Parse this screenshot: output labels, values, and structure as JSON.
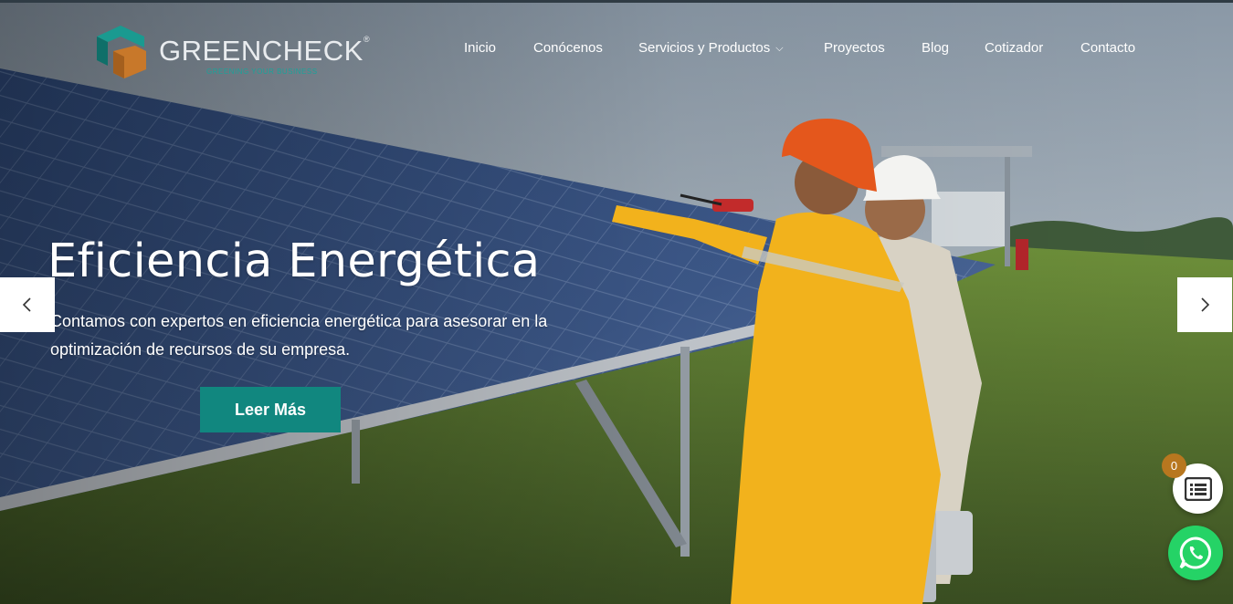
{
  "brand": {
    "name": "GREENCHECK",
    "registered_mark": "®",
    "tagline": "GREENING YOUR BUSINESS",
    "logo_colors": {
      "teal": "#1a9a90",
      "orange": "#c8782a",
      "dark_teal": "#0f6f69"
    }
  },
  "nav": {
    "items": [
      {
        "label": "Inicio",
        "has_dropdown": false
      },
      {
        "label": "Conócenos",
        "has_dropdown": false
      },
      {
        "label": "Servicios y Productos",
        "has_dropdown": true
      },
      {
        "label": "Proyectos",
        "has_dropdown": false
      },
      {
        "label": "Blog",
        "has_dropdown": false
      },
      {
        "label": "Cotizador",
        "has_dropdown": false
      },
      {
        "label": "Contacto",
        "has_dropdown": false
      }
    ]
  },
  "hero": {
    "title": "Eficiencia Energética",
    "subtitle": "Contamos con expertos en eficiencia energética para asesorar en la optimización de recursos de su empresa.",
    "cta_label": "Leer Más",
    "cta_color": "#11877f",
    "image_description_icon": "solar-panel-field"
  },
  "slider": {
    "prev_icon": "chevron-left-icon",
    "next_icon": "chevron-right-icon"
  },
  "widgets": {
    "list_count": "0",
    "list_icon": "list-icon",
    "whatsapp_icon": "whatsapp-icon",
    "badge_color": "#b8771f",
    "whatsapp_color": "#25d366"
  }
}
